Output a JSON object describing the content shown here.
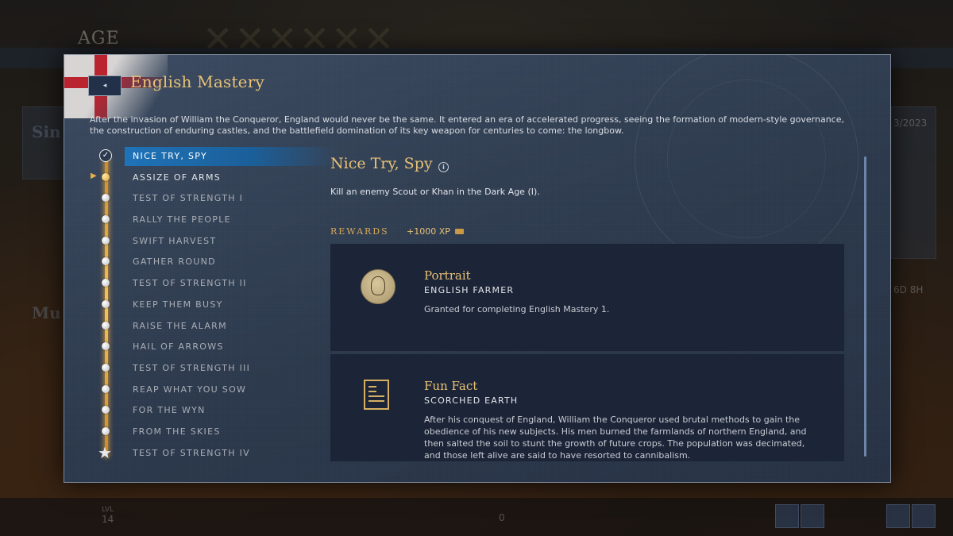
{
  "background": {
    "logo": "AGE",
    "date": "3/2023",
    "timer": "6D 8H",
    "level_label": "LVL",
    "level": "14",
    "counter": "0",
    "left_text_1": "Sin",
    "left_text_2": "Mu"
  },
  "modal": {
    "back_icon": "◂",
    "title": "English Mastery",
    "description": "After the invasion of William the Conqueror, England would never be the same. It entered an era of accelerated progress, seeing the formation of modern-style governance, the construction of enduring castles, and the battlefield domination of its key weapon for centuries to come: the longbow."
  },
  "milestones": [
    {
      "label": "NICE TRY, SPY",
      "state": "completed-selected"
    },
    {
      "label": "ASSIZE OF ARMS",
      "state": "current"
    },
    {
      "label": "TEST OF STRENGTH I",
      "state": "locked"
    },
    {
      "label": "RALLY THE PEOPLE",
      "state": "locked"
    },
    {
      "label": "SWIFT HARVEST",
      "state": "locked"
    },
    {
      "label": "GATHER ROUND",
      "state": "locked"
    },
    {
      "label": "TEST OF STRENGTH II",
      "state": "locked"
    },
    {
      "label": "KEEP THEM BUSY",
      "state": "locked"
    },
    {
      "label": "RAISE THE ALARM",
      "state": "locked"
    },
    {
      "label": "HAIL OF ARROWS",
      "state": "locked"
    },
    {
      "label": "TEST OF STRENGTH III",
      "state": "locked"
    },
    {
      "label": "REAP WHAT YOU SOW",
      "state": "locked"
    },
    {
      "label": "FOR THE WYN",
      "state": "locked"
    },
    {
      "label": "FROM THE SKIES",
      "state": "locked"
    },
    {
      "label": "TEST OF STRENGTH IV",
      "state": "final"
    }
  ],
  "detail": {
    "title": "Nice Try, Spy",
    "info_icon": "i",
    "description": "Kill an enemy Scout or Khan in the Dark Age (I).",
    "rewards_label": "REWARDS",
    "xp": "+1000 XP",
    "rewards": [
      {
        "icon": "portrait-icon",
        "title": "Portrait",
        "subtitle": "ENGLISH FARMER",
        "body": "Granted for completing English Mastery 1."
      },
      {
        "icon": "document-icon",
        "title": "Fun Fact",
        "subtitle": "SCORCHED EARTH",
        "body": "After his conquest of England, William the Conqueror used brutal methods to gain the obedience of his new subjects. His men burned the farmlands of northern England, and then salted the soil to stunt the growth of future crops. The population was decimated, and those left alive are said to have resorted to cannibalism."
      }
    ]
  },
  "colors": {
    "accent_gold": "#e8c276",
    "selected_blue": "#1f73b8",
    "card_bg": "#1c2437",
    "panel_bg": "#2c394c"
  }
}
